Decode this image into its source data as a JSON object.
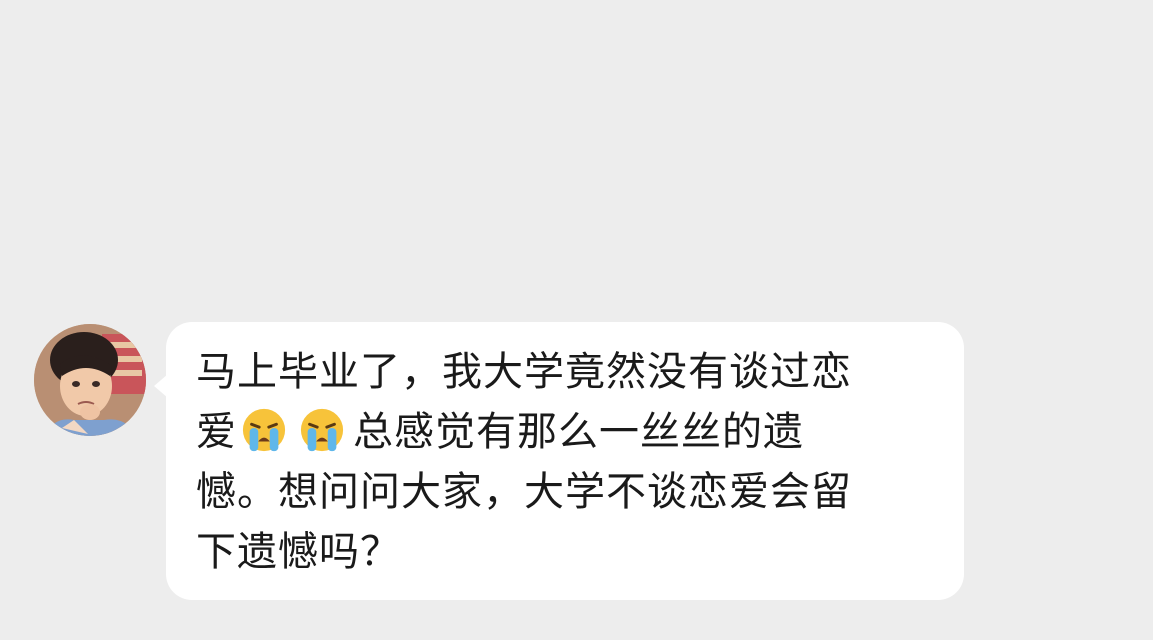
{
  "chat": {
    "message": {
      "line1": "马上毕业了，我大学竟然没有谈过恋",
      "line2_start": "爱",
      "line2_end": "总感觉有那么一丝丝的遗",
      "line3": "憾。想问问大家，大学不谈恋爱会留",
      "line4": "下遗憾吗？",
      "emoji_1": "loudly-crying-face-icon",
      "emoji_2": "loudly-crying-face-icon"
    },
    "colors": {
      "background": "#ededed",
      "bubble": "#ffffff",
      "text": "#1a1a1a"
    }
  }
}
